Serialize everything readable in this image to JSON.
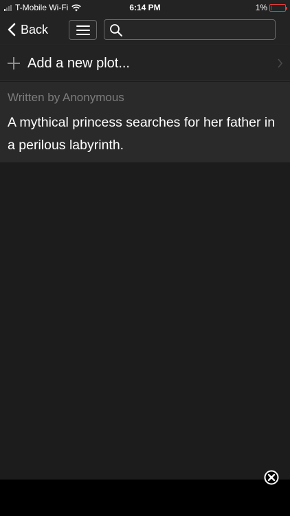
{
  "status_bar": {
    "carrier": "T-Mobile Wi-Fi",
    "time": "6:14 PM",
    "battery_percent": "1%",
    "battery_level": 0.01
  },
  "nav": {
    "back_label": "Back",
    "search_placeholder": ""
  },
  "add_plot": {
    "label": "Add a new plot..."
  },
  "plot": {
    "author": "Written by Anonymous",
    "text": "A mythical princess searches for her father in a perilous labyrinth."
  },
  "colors": {
    "background": "#1c1c1c",
    "bar": "#232323",
    "card": "#2a2a2a",
    "muted_text": "#7d7d7d",
    "battery_low": "#e23b3b"
  }
}
